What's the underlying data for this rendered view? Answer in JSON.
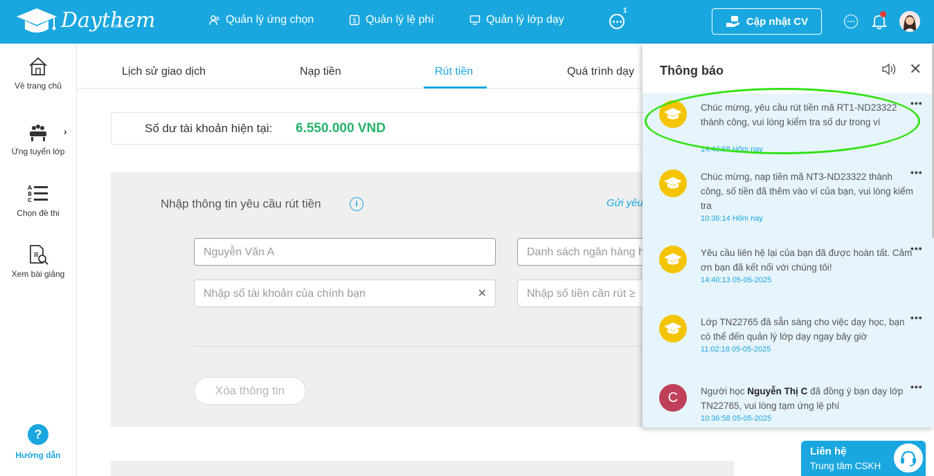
{
  "header": {
    "logo_text": "Daythem",
    "logo_sub": ".com",
    "nav": [
      {
        "label": "Quản lý ứng chọn",
        "icon": "users-icon"
      },
      {
        "label": "Quản lý lệ phí",
        "icon": "dollar-icon"
      },
      {
        "label": "Quản lý lớp dạy",
        "icon": "monitor-icon"
      }
    ],
    "more_count": "1",
    "cv_button": "Cập nhật CV"
  },
  "sidebar": {
    "items": [
      {
        "label": "Về trang chủ",
        "icon": "home-icon"
      },
      {
        "label": "Ứng tuyển lớp",
        "icon": "classroom-icon"
      },
      {
        "label": "Chọn đề thi",
        "icon": "exam-list-icon"
      },
      {
        "label": "Xem bài giảng",
        "icon": "lecture-icon"
      }
    ],
    "help_symbol": "?",
    "help_label": "Hướng dẫn"
  },
  "tabs": [
    "Lịch sử giao dịch",
    "Nạp tiền",
    "Rút tiền",
    "Quá trình dạy"
  ],
  "active_tab": "Rút tiền",
  "balance": {
    "label": "Số dư tài khoản hiện tại:",
    "value": "6.550.000 VND"
  },
  "form": {
    "title": "Nhập thông tin yêu cầu rút tiền",
    "info_symbol": "i",
    "send_link": "Gửi yêu",
    "name_placeholder": "Nguyễn Văn A",
    "bank_placeholder": "Danh sách ngân hàng h",
    "account_placeholder": "Nhập số tài khoản của chính bạn",
    "amount_placeholder": "Nhập số tiền cần rút ≥",
    "clear_symbol": "✕",
    "reset_button": "Xóa thông tin"
  },
  "notifications": {
    "title": "Thông báo",
    "close_symbol": "✕",
    "menu_symbol": "•••",
    "items": [
      {
        "text": "Chúc mừng, yêu cầu rút tiền mã RT1-ND23322 thành công, vui lòng kiểm tra số dư trong ví",
        "time": "14:43:58 Hôm nay"
      },
      {
        "text": "Chúc mừng, nạp tiền mã NT3-ND23322 thành công, số tiền đã thêm vào ví của bạn, vui lòng kiểm tra",
        "time": "10:36:14 Hôm nay"
      },
      {
        "text": "Yêu cầu liên hệ lại của bạn đã được hoàn tất. Cảm ơn bạn đã kết nối với chúng tôi!",
        "time": "14:40:13 05-05-2025"
      },
      {
        "text": "Lớp TN22765 đã sẵn sàng cho việc dạy học, bạn có thể đến quản lý lớp dạy ngay bây giờ",
        "time": "11:02:18 05-05-2025"
      },
      {
        "avatar_letter": "C",
        "text_before": "Người học ",
        "text_bold": "Nguyễn Thị C",
        "text_after": " đã đồng ý bạn dạy lớp TN22765, vui lòng tạm ứng lệ phí",
        "time": "10:36:58 05-05-2025"
      }
    ]
  },
  "contact": {
    "title": "Liên hệ",
    "subtitle": "Trung tâm CSKH"
  },
  "colors": {
    "primary": "#1aa7e0",
    "balance_green": "#27b36a",
    "notif_bg": "#e6f4fb",
    "highlight": "#31e212"
  }
}
